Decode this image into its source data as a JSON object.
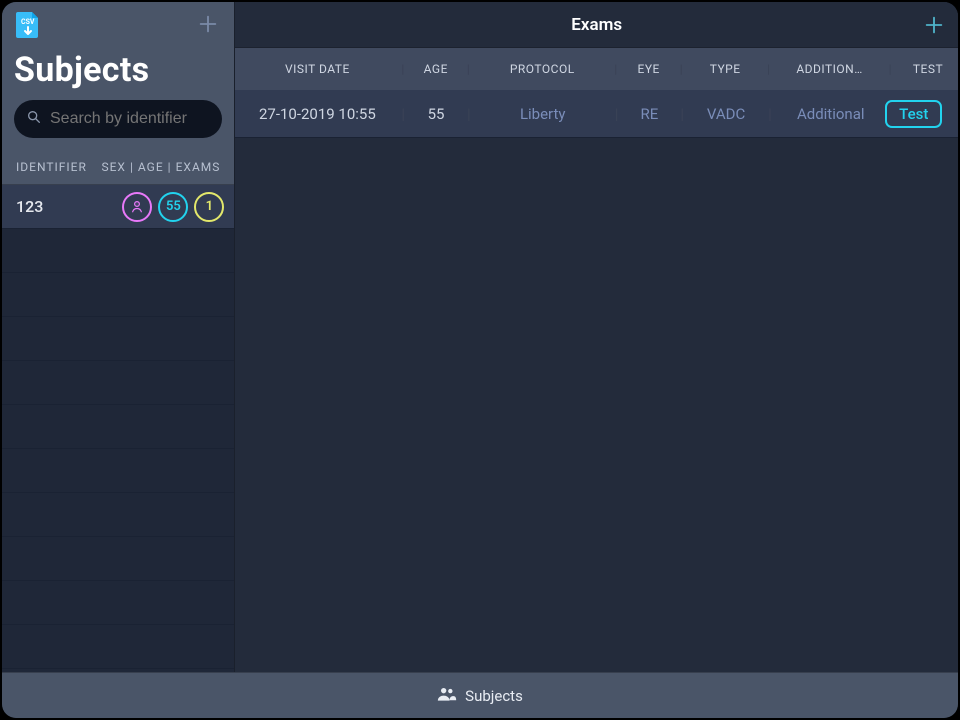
{
  "sidebar": {
    "title": "Subjects",
    "search_placeholder": "Search by identifier",
    "column_identifier": "IDENTIFIER",
    "column_sex": "SEX",
    "column_age": "AGE",
    "column_exams": "EXAMS",
    "subjects": [
      {
        "identifier": "123",
        "sex_icon": "person",
        "age": "55",
        "exams": "1"
      }
    ]
  },
  "content": {
    "title": "Exams",
    "columns": {
      "visit_date": "VISIT DATE",
      "age": "AGE",
      "protocol": "PROTOCOL",
      "eye": "EYE",
      "type": "TYPE",
      "additional": "ADDITION…",
      "test": "TEST"
    },
    "rows": [
      {
        "visit_date": "27-10-2019 10:55",
        "age": "55",
        "protocol": "Liberty",
        "eye": "RE",
        "type": "VADC",
        "additional": "Additional",
        "test": "Test"
      }
    ]
  },
  "bottombar": {
    "label": "Subjects"
  }
}
